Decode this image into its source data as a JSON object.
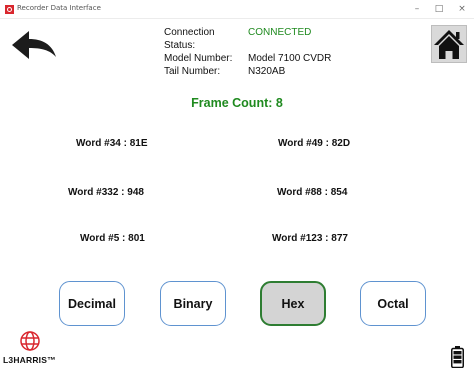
{
  "window": {
    "title": "Recorder Data Interface",
    "controls": {
      "minimize": "–",
      "maximize": "□",
      "close": "×"
    }
  },
  "nav": {
    "back_icon": "back-arrow-icon",
    "home_icon": "home-icon"
  },
  "connection": {
    "status_label": "Connection Status:",
    "status_value": "CONNECTED",
    "status_color": "#1f8a1f",
    "model_label": "Model Number:",
    "model_value": "Model 7100 CVDR",
    "tail_label": "Tail Number:",
    "tail_value": "N320AB"
  },
  "frame": {
    "label": "Frame Count: 8"
  },
  "words": [
    {
      "label": "Word #34 :",
      "value": "81E"
    },
    {
      "label": "Word #49 :",
      "value": "82D"
    },
    {
      "label": "Word #332 :",
      "value": "948"
    },
    {
      "label": "Word #88 :",
      "value": "854"
    },
    {
      "label": "Word #5 :",
      "value": "801"
    },
    {
      "label": "Word #123 :",
      "value": "877"
    }
  ],
  "modes": {
    "selected": "Hex",
    "buttons": [
      {
        "label": "Decimal"
      },
      {
        "label": "Binary"
      },
      {
        "label": "Hex"
      },
      {
        "label": "Octal"
      }
    ]
  },
  "footer": {
    "logo_text": "L3HARRIS™",
    "logo_icon": "l3harris-logo-icon",
    "battery_icon": "battery-icon"
  }
}
